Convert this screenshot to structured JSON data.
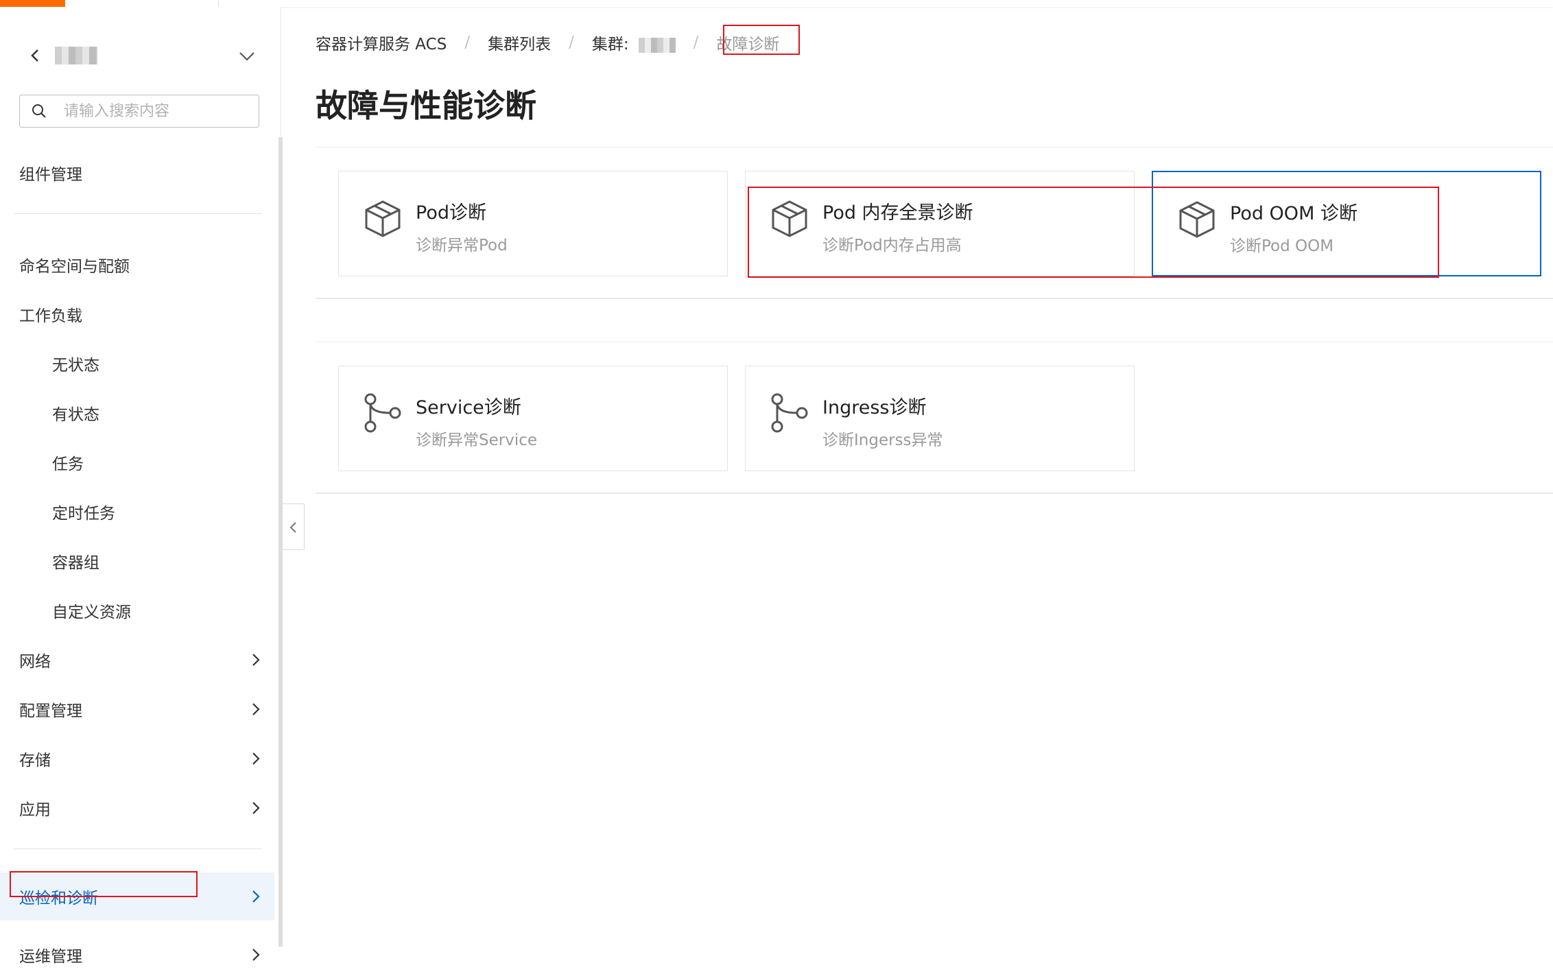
{
  "sidebar": {
    "search_placeholder": "请输入搜索内容",
    "items": [
      {
        "label": "组件管理"
      },
      {
        "label": "命名空间与配额"
      },
      {
        "label": "工作负载"
      },
      {
        "label": "无状态"
      },
      {
        "label": "有状态"
      },
      {
        "label": "任务"
      },
      {
        "label": "定时任务"
      },
      {
        "label": "容器组"
      },
      {
        "label": "自定义资源"
      },
      {
        "label": "网络"
      },
      {
        "label": "配置管理"
      },
      {
        "label": "存储"
      },
      {
        "label": "应用"
      },
      {
        "label": "巡检和诊断"
      },
      {
        "label": "运维管理"
      }
    ]
  },
  "breadcrumb": {
    "items": [
      "容器计算服务 ACS",
      "集群列表",
      "集群:",
      "故障诊断"
    ]
  },
  "page": {
    "title": "故障与性能诊断"
  },
  "cards": [
    {
      "title": "Pod诊断",
      "desc": "诊断异常Pod",
      "icon": "package-icon"
    },
    {
      "title": "Pod 内存全景诊断",
      "desc": "诊断Pod内存占用高",
      "icon": "package-icon"
    },
    {
      "title": "Pod OOM 诊断",
      "desc": "诊断Pod OOM",
      "icon": "package-icon"
    },
    {
      "title": "Service诊断",
      "desc": "诊断异常Service",
      "icon": "branch-icon"
    },
    {
      "title": "Ingress诊断",
      "desc": "诊断Ingerss异常",
      "icon": "branch-icon"
    }
  ],
  "colors": {
    "accent": "#ff6a00",
    "active": "#0064c8",
    "highlight": "#e0141e"
  }
}
